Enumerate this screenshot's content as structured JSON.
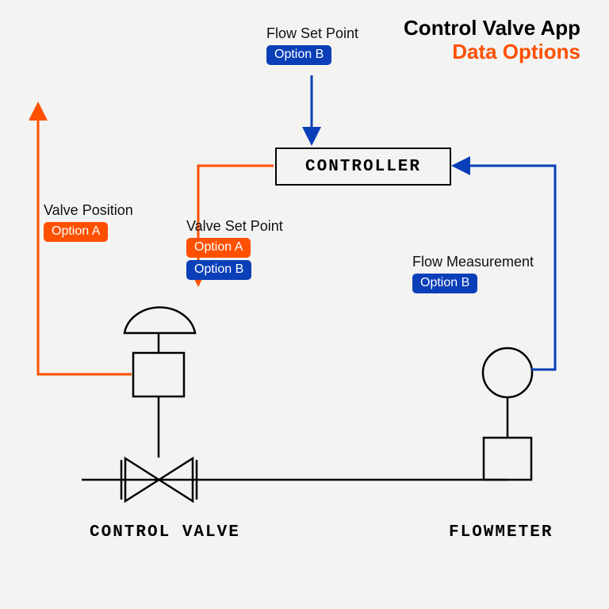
{
  "header": {
    "title_line1": "Control Valve App",
    "title_line2": "Data Options"
  },
  "blocks": {
    "controller": "CONTROLLER",
    "control_valve": "CONTROL VALVE",
    "flowmeter": "FLOWMETER"
  },
  "labels": {
    "flow_set_point": {
      "text": "Flow Set Point",
      "tags": [
        "Option B"
      ]
    },
    "valve_position": {
      "text": "Valve Position",
      "tags": [
        "Option A"
      ]
    },
    "valve_set_point": {
      "text": "Valve Set Point",
      "tags": [
        "Option A",
        "Option B"
      ]
    },
    "flow_measurement": {
      "text": "Flow Measurement",
      "tags": [
        "Option B"
      ]
    }
  },
  "colors": {
    "orange": "#ff5000",
    "blue": "#0a3fb8",
    "black": "#000000"
  },
  "chart_data": {
    "type": "diagram",
    "nodes": [
      {
        "id": "controller",
        "label": "CONTROLLER"
      },
      {
        "id": "control_valve",
        "label": "CONTROL VALVE"
      },
      {
        "id": "flowmeter",
        "label": "FLOWMETER"
      }
    ],
    "edges": [
      {
        "from": "flow_set_point_input",
        "to": "controller",
        "signal": "Flow Set Point",
        "options": [
          "B"
        ],
        "color": "blue"
      },
      {
        "from": "controller",
        "to": "control_valve",
        "signal": "Valve Set Point",
        "options": [
          "A",
          "B"
        ],
        "color": "orange"
      },
      {
        "from": "control_valve",
        "to": "external_out",
        "signal": "Valve Position",
        "options": [
          "A"
        ],
        "color": "orange"
      },
      {
        "from": "flowmeter",
        "to": "controller",
        "signal": "Flow Measurement",
        "options": [
          "B"
        ],
        "color": "blue"
      },
      {
        "from": "control_valve",
        "to": "flowmeter",
        "signal": "process line",
        "options": [],
        "color": "black"
      }
    ]
  }
}
